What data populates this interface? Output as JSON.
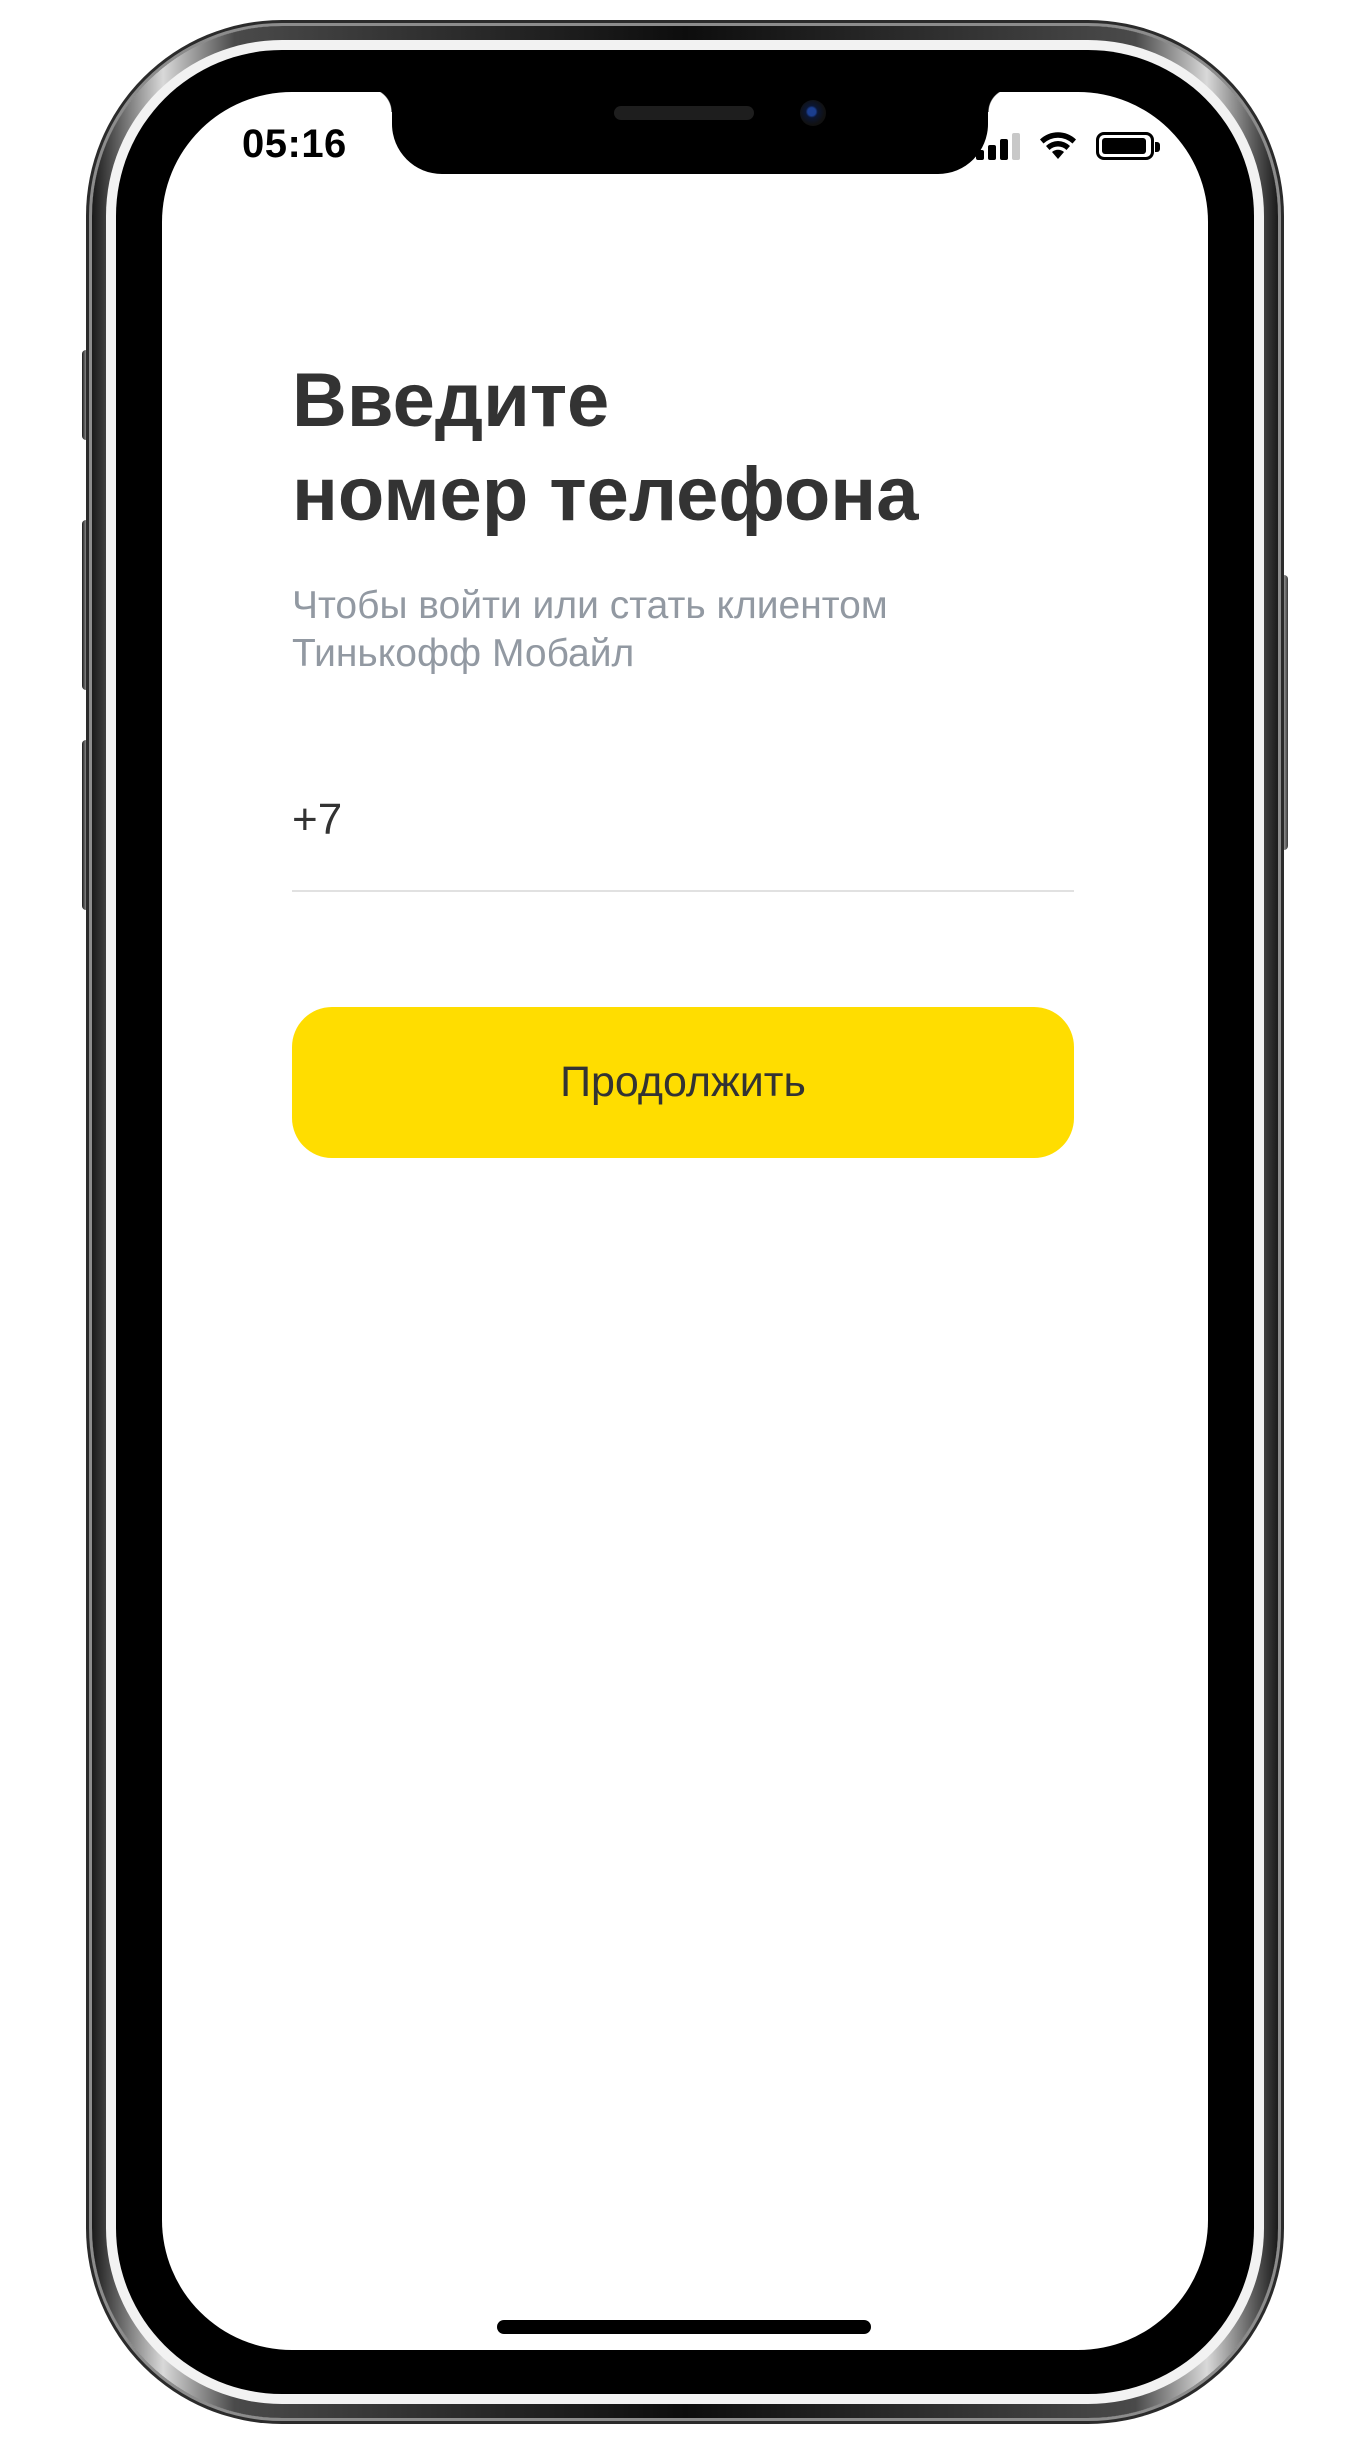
{
  "status_bar": {
    "time": "05:16",
    "icons": [
      "cellular-signal-icon",
      "wifi-icon",
      "battery-icon"
    ]
  },
  "login": {
    "title_line1": "Введите",
    "title_line2": "номер телефона",
    "subtitle_line1": "Чтобы войти или стать клиентом",
    "subtitle_line2": "Тинькофф Мобайл",
    "phone_field_value": "+7",
    "continue_label": "Продолжить"
  },
  "colors": {
    "accent": "#ffdd00",
    "title_text": "#333333",
    "subtitle_text": "#9299a2",
    "divider": "#e1e1e1"
  }
}
